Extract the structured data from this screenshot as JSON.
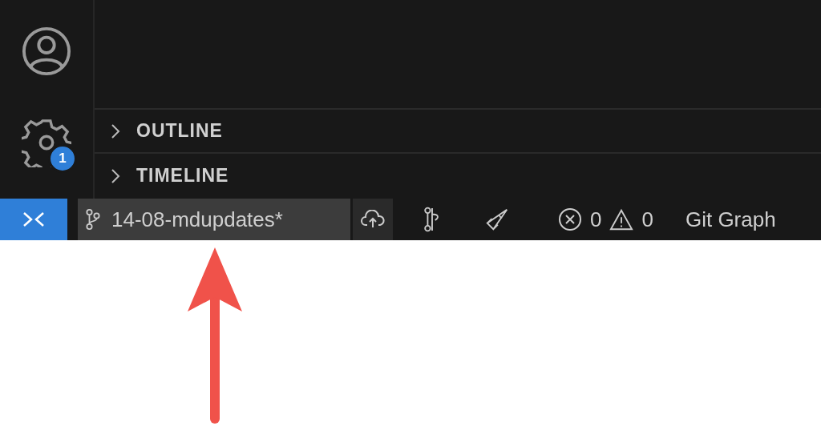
{
  "activity_bar": {
    "settings_badge": "1"
  },
  "sidebar": {
    "sections": [
      {
        "label": "OUTLINE",
        "expanded": false
      },
      {
        "label": "TIMELINE",
        "expanded": false
      }
    ]
  },
  "status_bar": {
    "branch": "14-08-mdupdates*",
    "errors": "0",
    "warnings": "0",
    "git_graph": "Git Graph"
  }
}
